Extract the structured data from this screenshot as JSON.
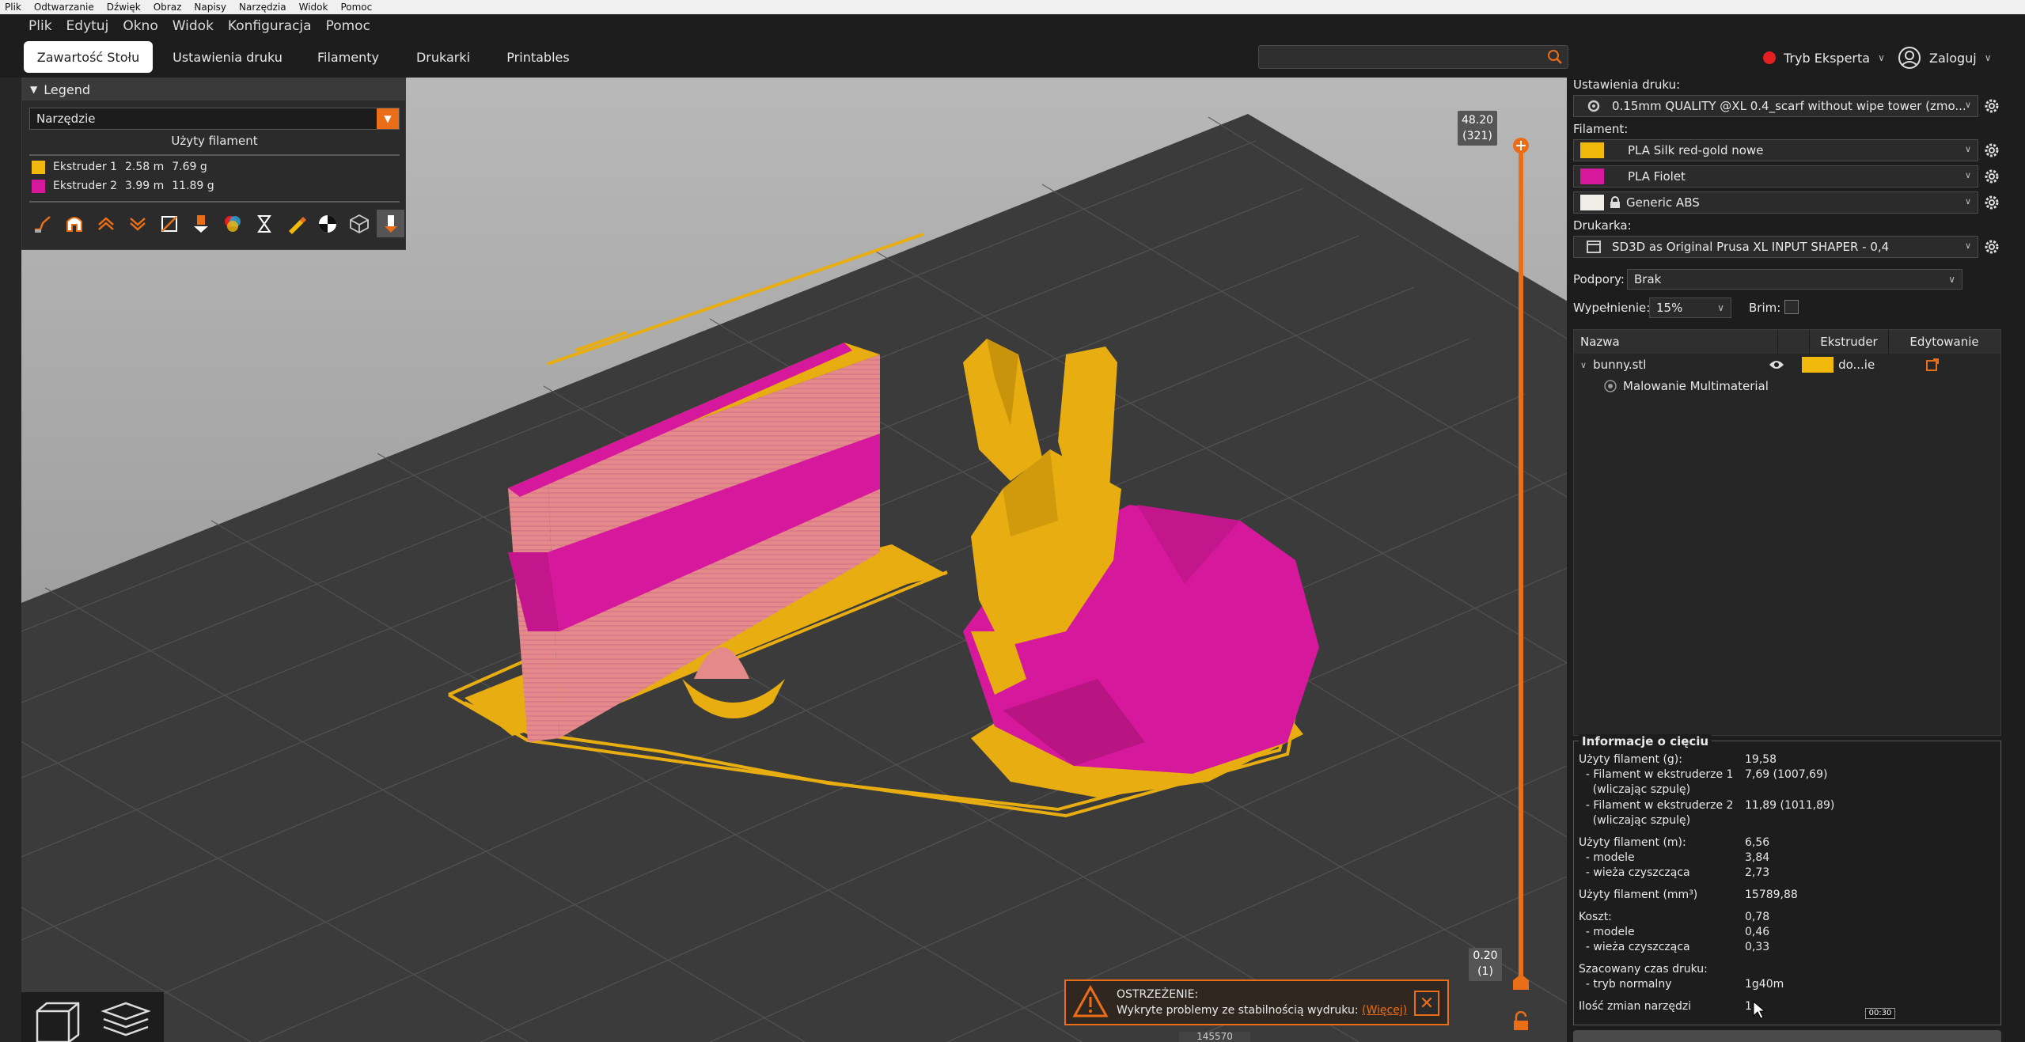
{
  "os_menu": [
    "Plik",
    "Odtwarzanie",
    "Dźwięk",
    "Obraz",
    "Napisy",
    "Narzędzia",
    "Widok",
    "Pomoc"
  ],
  "app_menu": [
    "Plik",
    "Edytuj",
    "Okno",
    "Widok",
    "Konfiguracja",
    "Pomoc"
  ],
  "tabs": [
    "Zawartość Stołu",
    "Ustawienia druku",
    "Filamenty",
    "Drukarki",
    "Printables"
  ],
  "search": {
    "placeholder": ""
  },
  "mode_label": "Tryb Eksperta",
  "login_label": "Zaloguj",
  "legend": {
    "title": "Legend",
    "view_select": "Narzędzie",
    "section": "Użyty filament",
    "rows": [
      {
        "label": "Ekstruder 1",
        "length": "2.58 m",
        "weight": "7.69 g",
        "color": "#f0b90c"
      },
      {
        "label": "Ekstruder 2",
        "length": "3.99 m",
        "weight": "11.89 g",
        "color": "#d6189c"
      }
    ],
    "icons": [
      "travel-icon",
      "wipe-icon",
      "retractions-icon",
      "deretractions-icon",
      "seams-icon",
      "tool-changes-icon",
      "color-changes-icon",
      "pause-icon",
      "custom-gcode-icon",
      "center-of-gravity-icon",
      "shells-icon",
      "tool-marker-icon"
    ]
  },
  "slider": {
    "top_value": "48.20",
    "top_layer": "(321)",
    "bottom_value": "0.20",
    "bottom_layer": "(1)"
  },
  "warning": {
    "title": "OSTRZEŻENIE:",
    "message": "Wykryte problemy ze stabilnością wydruku:",
    "link": "(Więcej)"
  },
  "bottom_hint": "145570",
  "sidebar": {
    "print_settings_label": "Ustawienia druku:",
    "print_profile": "0.15mm QUALITY @XL 0.4_scarf without wipe tower (zmo...",
    "filament_label": "Filament:",
    "filaments": [
      {
        "name": "PLA Silk red-gold nowe",
        "color": "#f0b90c"
      },
      {
        "name": "PLA Fiolet",
        "color": "#d6189c"
      },
      {
        "name": "Generic ABS",
        "color": "#f0ece8"
      }
    ],
    "printer_label": "Drukarka:",
    "printer": "SD3D as Original Prusa XL INPUT SHAPER - 0,4",
    "supports_label": "Podpory:",
    "supports_value": "Brak",
    "infill_label": "Wypełnienie:",
    "infill_value": "15%",
    "brim_label": "Brim:",
    "list_headers": [
      "Nazwa",
      "Ekstruder",
      "Edytowanie"
    ],
    "objects": [
      {
        "name": "bunny.stl",
        "extruder": "do...ie",
        "color": "#f0b90c"
      }
    ],
    "sub_item": "Malowanie Multimaterial"
  },
  "slice_info": {
    "title": "Informacje o cięciu",
    "rows": [
      {
        "k": "Użyty filament (g):",
        "v": "19,58"
      },
      {
        "k": "  - Filament w ekstruderze 1",
        "v": "7,69 (1007,69)"
      },
      {
        "k": "    (wliczając szpulę)",
        "v": ""
      },
      {
        "k": "  - Filament w ekstruderze 2",
        "v": "11,89 (1011,89)"
      },
      {
        "k": "    (wliczając szpulę)",
        "v": ""
      },
      {
        "k": "Użyty filament (m):",
        "v": "6,56"
      },
      {
        "k": "  - modele",
        "v": "3,84"
      },
      {
        "k": "  - wieża czyszcząca",
        "v": "2,73"
      },
      {
        "k": "Użyty filament (mm³)",
        "v": "15789,88"
      },
      {
        "k": "Koszt:",
        "v": "0,78"
      },
      {
        "k": "  - modele",
        "v": "0,46"
      },
      {
        "k": "  - wieża czyszcząca",
        "v": "0,33"
      },
      {
        "k": "Szacowany czas druku:",
        "v": ""
      },
      {
        "k": "  - tryb normalny",
        "v": "1g40m"
      },
      {
        "k": "Ilość zmian narzędzi",
        "v": "1"
      }
    ]
  },
  "tooltip_time": "00:30",
  "colors": {
    "accent": "#ea6e18",
    "extruder1": "#f0b90c",
    "extruder2": "#d6189c"
  }
}
